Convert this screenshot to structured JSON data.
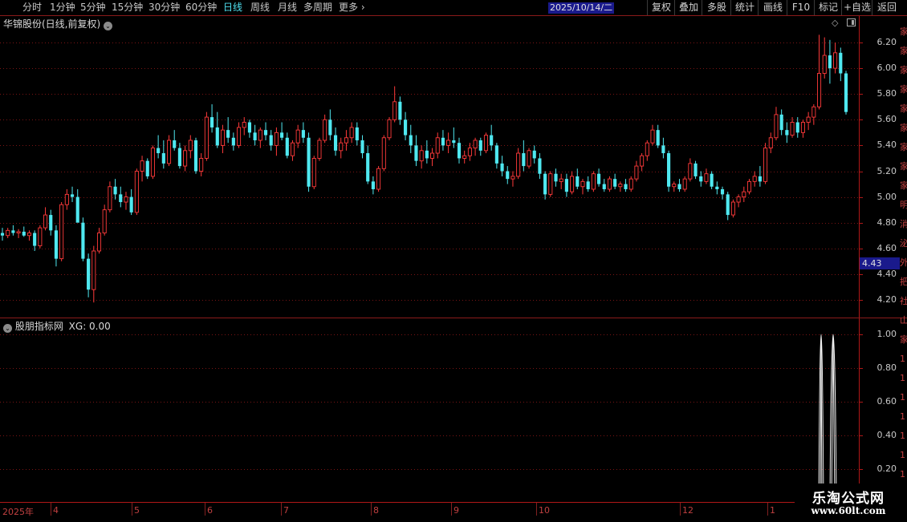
{
  "toolbar": {
    "periods": [
      "分时",
      "1分钟",
      "5分钟",
      "15分钟",
      "30分钟",
      "60分钟",
      "日线",
      "周线",
      "月线",
      "多周期",
      "更多"
    ],
    "active_period": "日线",
    "more_arrow": "›",
    "tools": [
      "复权",
      "叠加",
      "多股",
      "统计",
      "画线",
      "F10",
      "标记",
      "+自选",
      "返回"
    ]
  },
  "main_pane": {
    "title": "华锦股份(日线,前复权)",
    "y_ticks": [
      "6.20",
      "6.00",
      "5.80",
      "5.60",
      "5.40",
      "5.20",
      "5.00",
      "4.80",
      "4.60",
      "4.40",
      "4.20"
    ],
    "current_price_label": "4.43",
    "colors": {
      "up": "#ff3a3a",
      "down": "#4fe8f0",
      "grid": "#7a1414",
      "axis": "#b01818"
    }
  },
  "indicator_pane": {
    "name": "股朋指标网",
    "value_label": "XG: 0.00",
    "y_ticks": [
      "1.00",
      "0.80",
      "0.60",
      "0.40",
      "0.20"
    ]
  },
  "date_axis": {
    "year_label": "2025年",
    "months": [
      "4",
      "5",
      "6",
      "7",
      "8",
      "9",
      "10",
      "12",
      "1"
    ],
    "cursor_date": "2025/10/14/二"
  },
  "watermark": {
    "title": "乐淘公式网",
    "url": "www.60lt.com"
  },
  "right_strip": {
    "glyphs": [
      "家",
      "家",
      "家",
      "家",
      "家",
      "家",
      "家",
      "家",
      "家",
      "明",
      "消",
      "泌",
      "外",
      "把",
      "社",
      "山",
      "家",
      "1",
      "1",
      "1",
      "1",
      "1",
      "1",
      "1",
      "1"
    ]
  },
  "chart_data": {
    "type": "candlestick",
    "title": "华锦股份(日线,前复权)",
    "ylim": [
      4.1,
      6.3
    ],
    "y_ticks": [
      6.2,
      6.0,
      5.8,
      5.6,
      5.4,
      5.2,
      5.0,
      4.8,
      4.6,
      4.4,
      4.2
    ],
    "x_months": [
      "2025年",
      "4",
      "5",
      "6",
      "7",
      "8",
      "9",
      "10",
      "12",
      "1"
    ],
    "series": [
      {
        "name": "价格",
        "ohlc": [
          [
            4.72,
            4.76,
            4.66,
            4.7
          ],
          [
            4.7,
            4.76,
            4.68,
            4.74
          ],
          [
            4.74,
            4.78,
            4.7,
            4.72
          ],
          [
            4.72,
            4.75,
            4.68,
            4.73
          ],
          [
            4.73,
            4.77,
            4.69,
            4.7
          ],
          [
            4.7,
            4.74,
            4.66,
            4.72
          ],
          [
            4.72,
            4.74,
            4.58,
            4.62
          ],
          [
            4.62,
            4.78,
            4.6,
            4.76
          ],
          [
            4.76,
            4.92,
            4.74,
            4.86
          ],
          [
            4.86,
            4.9,
            4.7,
            4.74
          ],
          [
            4.74,
            4.78,
            4.46,
            4.52
          ],
          [
            4.52,
            4.96,
            4.5,
            4.94
          ],
          [
            4.94,
            5.06,
            4.9,
            5.02
          ],
          [
            5.02,
            5.08,
            4.96,
            5.0
          ],
          [
            5.0,
            5.06,
            4.82,
            4.8
          ],
          [
            4.8,
            4.84,
            4.5,
            4.52
          ],
          [
            4.52,
            4.56,
            4.22,
            4.28
          ],
          [
            4.28,
            4.62,
            4.18,
            4.58
          ],
          [
            4.58,
            4.76,
            4.56,
            4.72
          ],
          [
            4.72,
            4.94,
            4.7,
            4.9
          ],
          [
            4.9,
            5.12,
            4.88,
            5.08
          ],
          [
            5.08,
            5.14,
            4.98,
            5.02
          ],
          [
            5.02,
            5.08,
            4.92,
            4.96
          ],
          [
            4.96,
            5.04,
            4.9,
            5.0
          ],
          [
            5.0,
            5.06,
            4.86,
            4.88
          ],
          [
            4.88,
            5.22,
            4.86,
            5.2
          ],
          [
            5.2,
            5.32,
            5.12,
            5.28
          ],
          [
            5.28,
            5.3,
            5.14,
            5.16
          ],
          [
            5.16,
            5.4,
            5.14,
            5.38
          ],
          [
            5.38,
            5.48,
            5.3,
            5.34
          ],
          [
            5.34,
            5.44,
            5.22,
            5.26
          ],
          [
            5.26,
            5.48,
            5.24,
            5.44
          ],
          [
            5.44,
            5.52,
            5.36,
            5.38
          ],
          [
            5.38,
            5.42,
            5.22,
            5.24
          ],
          [
            5.24,
            5.4,
            5.2,
            5.36
          ],
          [
            5.36,
            5.48,
            5.3,
            5.44
          ],
          [
            5.44,
            5.46,
            5.18,
            5.2
          ],
          [
            5.2,
            5.34,
            5.16,
            5.3
          ],
          [
            5.3,
            5.66,
            5.28,
            5.62
          ],
          [
            5.62,
            5.72,
            5.5,
            5.54
          ],
          [
            5.54,
            5.66,
            5.38,
            5.4
          ],
          [
            5.4,
            5.56,
            5.34,
            5.52
          ],
          [
            5.52,
            5.62,
            5.42,
            5.46
          ],
          [
            5.46,
            5.5,
            5.36,
            5.4
          ],
          [
            5.4,
            5.58,
            5.38,
            5.54
          ],
          [
            5.54,
            5.62,
            5.48,
            5.58
          ],
          [
            5.58,
            5.6,
            5.46,
            5.5
          ],
          [
            5.5,
            5.56,
            5.4,
            5.44
          ],
          [
            5.44,
            5.54,
            5.38,
            5.52
          ],
          [
            5.52,
            5.58,
            5.44,
            5.48
          ],
          [
            5.48,
            5.52,
            5.36,
            5.4
          ],
          [
            5.4,
            5.54,
            5.32,
            5.5
          ],
          [
            5.5,
            5.58,
            5.44,
            5.46
          ],
          [
            5.46,
            5.5,
            5.3,
            5.32
          ],
          [
            5.32,
            5.44,
            5.28,
            5.42
          ],
          [
            5.42,
            5.56,
            5.38,
            5.52
          ],
          [
            5.52,
            5.58,
            5.42,
            5.46
          ],
          [
            5.46,
            5.5,
            5.04,
            5.08
          ],
          [
            5.08,
            5.32,
            5.06,
            5.3
          ],
          [
            5.3,
            5.46,
            5.28,
            5.44
          ],
          [
            5.44,
            5.64,
            5.42,
            5.6
          ],
          [
            5.6,
            5.68,
            5.44,
            5.48
          ],
          [
            5.48,
            5.54,
            5.32,
            5.36
          ],
          [
            5.36,
            5.46,
            5.3,
            5.42
          ],
          [
            5.42,
            5.52,
            5.36,
            5.46
          ],
          [
            5.46,
            5.58,
            5.42,
            5.54
          ],
          [
            5.54,
            5.58,
            5.4,
            5.44
          ],
          [
            5.44,
            5.48,
            5.3,
            5.34
          ],
          [
            5.34,
            5.4,
            5.1,
            5.12
          ],
          [
            5.12,
            5.16,
            5.02,
            5.06
          ],
          [
            5.06,
            5.24,
            5.04,
            5.22
          ],
          [
            5.22,
            5.48,
            5.2,
            5.46
          ],
          [
            5.46,
            5.62,
            5.44,
            5.6
          ],
          [
            5.6,
            5.86,
            5.58,
            5.74
          ],
          [
            5.74,
            5.78,
            5.56,
            5.6
          ],
          [
            5.6,
            5.66,
            5.44,
            5.48
          ],
          [
            5.48,
            5.56,
            5.34,
            5.4
          ],
          [
            5.4,
            5.48,
            5.24,
            5.28
          ],
          [
            5.28,
            5.4,
            5.22,
            5.36
          ],
          [
            5.36,
            5.44,
            5.26,
            5.3
          ],
          [
            5.3,
            5.38,
            5.24,
            5.34
          ],
          [
            5.34,
            5.5,
            5.3,
            5.46
          ],
          [
            5.46,
            5.52,
            5.36,
            5.4
          ],
          [
            5.4,
            5.5,
            5.34,
            5.44
          ],
          [
            5.44,
            5.54,
            5.38,
            5.42
          ],
          [
            5.42,
            5.46,
            5.26,
            5.3
          ],
          [
            5.3,
            5.36,
            5.26,
            5.32
          ],
          [
            5.32,
            5.42,
            5.28,
            5.38
          ],
          [
            5.38,
            5.46,
            5.32,
            5.44
          ],
          [
            5.44,
            5.46,
            5.32,
            5.36
          ],
          [
            5.36,
            5.5,
            5.34,
            5.48
          ],
          [
            5.48,
            5.56,
            5.36,
            5.4
          ],
          [
            5.4,
            5.42,
            5.22,
            5.26
          ],
          [
            5.26,
            5.32,
            5.16,
            5.2
          ],
          [
            5.2,
            5.24,
            5.1,
            5.14
          ],
          [
            5.14,
            5.2,
            5.08,
            5.16
          ],
          [
            5.16,
            5.38,
            5.14,
            5.34
          ],
          [
            5.34,
            5.44,
            5.2,
            5.24
          ],
          [
            5.24,
            5.38,
            5.22,
            5.36
          ],
          [
            5.36,
            5.4,
            5.26,
            5.3
          ],
          [
            5.3,
            5.34,
            5.14,
            5.18
          ],
          [
            5.18,
            5.2,
            4.98,
            5.02
          ],
          [
            5.02,
            5.2,
            5.0,
            5.18
          ],
          [
            5.18,
            5.22,
            5.08,
            5.12
          ],
          [
            5.12,
            5.18,
            5.06,
            5.14
          ],
          [
            5.14,
            5.18,
            5.0,
            5.04
          ],
          [
            5.04,
            5.2,
            5.02,
            5.16
          ],
          [
            5.16,
            5.22,
            5.06,
            5.08
          ],
          [
            5.08,
            5.14,
            5.02,
            5.12
          ],
          [
            5.12,
            5.16,
            5.04,
            5.06
          ],
          [
            5.06,
            5.2,
            5.04,
            5.18
          ],
          [
            5.18,
            5.22,
            5.08,
            5.1
          ],
          [
            5.1,
            5.14,
            5.04,
            5.06
          ],
          [
            5.06,
            5.16,
            5.04,
            5.14
          ],
          [
            5.14,
            5.18,
            5.06,
            5.08
          ],
          [
            5.08,
            5.12,
            5.04,
            5.1
          ],
          [
            5.1,
            5.14,
            5.04,
            5.06
          ],
          [
            5.06,
            5.16,
            5.04,
            5.14
          ],
          [
            5.14,
            5.28,
            5.12,
            5.24
          ],
          [
            5.24,
            5.34,
            5.2,
            5.32
          ],
          [
            5.32,
            5.44,
            5.28,
            5.42
          ],
          [
            5.42,
            5.56,
            5.4,
            5.52
          ],
          [
            5.52,
            5.56,
            5.38,
            5.4
          ],
          [
            5.4,
            5.46,
            5.3,
            5.34
          ],
          [
            5.34,
            5.36,
            5.04,
            5.08
          ],
          [
            5.08,
            5.12,
            5.04,
            5.1
          ],
          [
            5.1,
            5.14,
            5.04,
            5.06
          ],
          [
            5.06,
            5.16,
            5.04,
            5.14
          ],
          [
            5.14,
            5.3,
            5.12,
            5.26
          ],
          [
            5.26,
            5.28,
            5.14,
            5.16
          ],
          [
            5.16,
            5.2,
            5.08,
            5.12
          ],
          [
            5.12,
            5.22,
            5.1,
            5.18
          ],
          [
            5.18,
            5.2,
            5.06,
            5.08
          ],
          [
            5.08,
            5.12,
            5.02,
            5.06
          ],
          [
            5.06,
            5.08,
            4.98,
            5.02
          ],
          [
            5.02,
            5.04,
            4.82,
            4.86
          ],
          [
            4.86,
            4.98,
            4.84,
            4.96
          ],
          [
            4.96,
            5.02,
            4.92,
            5.0
          ],
          [
            5.0,
            5.08,
            4.96,
            5.04
          ],
          [
            5.04,
            5.14,
            5.02,
            5.12
          ],
          [
            5.12,
            5.2,
            5.08,
            5.16
          ],
          [
            5.16,
            5.24,
            5.08,
            5.12
          ],
          [
            5.12,
            5.42,
            5.1,
            5.38
          ],
          [
            5.38,
            5.5,
            5.34,
            5.46
          ],
          [
            5.46,
            5.7,
            5.44,
            5.64
          ],
          [
            5.64,
            5.68,
            5.48,
            5.52
          ],
          [
            5.52,
            5.58,
            5.42,
            5.48
          ],
          [
            5.48,
            5.62,
            5.46,
            5.58
          ],
          [
            5.58,
            5.62,
            5.46,
            5.5
          ],
          [
            5.5,
            5.6,
            5.46,
            5.58
          ],
          [
            5.58,
            5.66,
            5.52,
            5.62
          ],
          [
            5.62,
            5.72,
            5.56,
            5.7
          ],
          [
            5.7,
            6.26,
            5.68,
            5.96
          ],
          [
            5.96,
            6.24,
            5.92,
            6.1
          ],
          [
            6.1,
            6.22,
            5.88,
            6.0
          ],
          [
            6.0,
            6.2,
            5.96,
            6.12
          ],
          [
            6.12,
            6.16,
            5.9,
            5.96
          ],
          [
            5.96,
            5.98,
            5.64,
            5.66
          ]
        ]
      }
    ]
  }
}
